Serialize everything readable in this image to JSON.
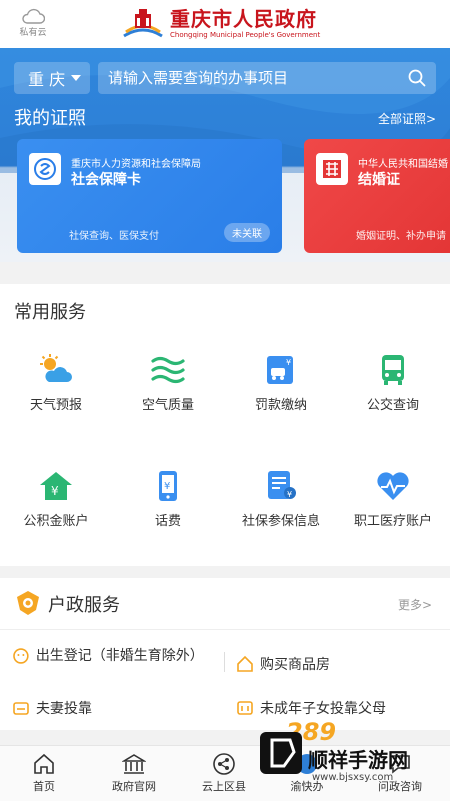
{
  "header": {
    "cloud_label": "私有云",
    "title_cn": "重庆市人民政府",
    "title_en": "Chongqing Municipal People's Government"
  },
  "search": {
    "city": "重 庆",
    "placeholder": "请输入需要查询的办事项目"
  },
  "licenses": {
    "title": "我的证照",
    "all_link": "全部证照>",
    "cards": [
      {
        "org": "重庆市人力资源和社会保障局",
        "name": "社会保障卡",
        "desc": "社保查询、医保支付",
        "badge": "未关联",
        "color": "#2a7ee8"
      },
      {
        "org": "中华人民共和国结婚",
        "name": "结婚证",
        "desc": "婚姻证明、补办申请",
        "color": "#e33535"
      }
    ]
  },
  "services": {
    "title": "常用服务",
    "items": [
      {
        "label": "天气预报",
        "icon": "weather-icon"
      },
      {
        "label": "空气质量",
        "icon": "air-quality-icon"
      },
      {
        "label": "罚款缴纳",
        "icon": "fine-payment-icon"
      },
      {
        "label": "公交查询",
        "icon": "bus-icon"
      },
      {
        "label": "公积金账户",
        "icon": "housing-fund-icon"
      },
      {
        "label": "话费",
        "icon": "phone-bill-icon"
      },
      {
        "label": "社保参保信息",
        "icon": "social-insurance-icon"
      },
      {
        "label": "职工医疗账户",
        "icon": "medical-account-icon"
      }
    ]
  },
  "hukou": {
    "title": "户政服务",
    "more": "更多>",
    "items": [
      "出生登记（非婚生育除外）",
      "购买商品房",
      "夫妻投靠",
      "未成年子女投靠父母"
    ]
  },
  "nav": {
    "items": [
      "首页",
      "政府官网",
      "云上区县",
      "渝快办",
      "问政咨询"
    ]
  },
  "watermark": {
    "num": "289",
    "title": "顺祥手游网",
    "url": "www.bjsxsy.com"
  },
  "colors": {
    "primary_blue": "#2e7fd6",
    "brand_red": "#c8151d",
    "accent_green": "#2bb673",
    "accent_orange": "#f5a623"
  }
}
